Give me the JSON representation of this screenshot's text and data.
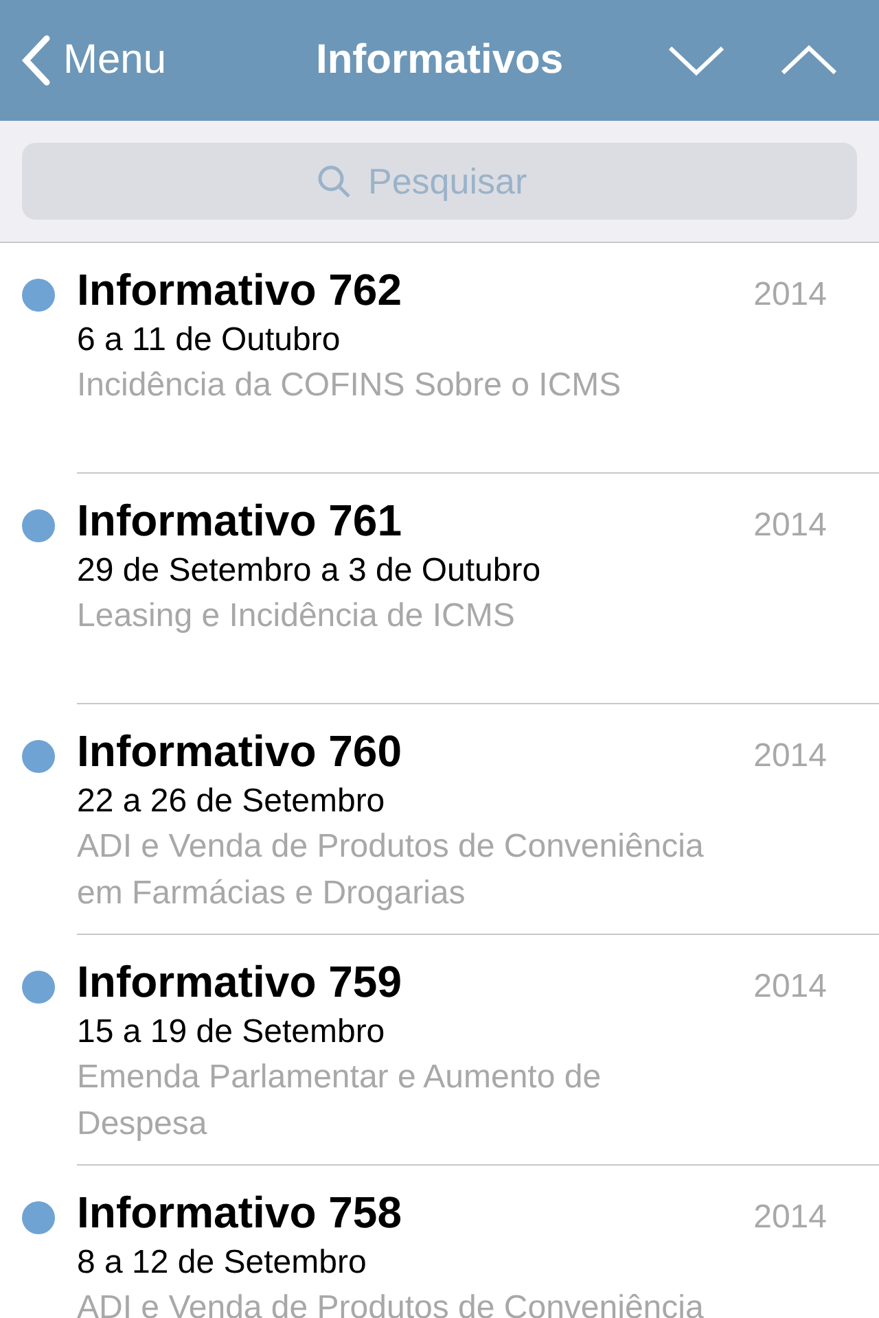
{
  "nav": {
    "back": "Menu",
    "title": "Informativos"
  },
  "search": {
    "placeholder": "Pesquisar"
  },
  "items": [
    {
      "title": "Informativo 762",
      "year": "2014",
      "period": "6 a 11 de Outubro",
      "subject": "Incidência da COFINS Sobre o ICMS",
      "unread": true
    },
    {
      "title": "Informativo 761",
      "year": "2014",
      "period": "29 de Setembro a 3 de Outubro",
      "subject": "Leasing e Incidência de ICMS",
      "unread": true
    },
    {
      "title": "Informativo 760",
      "year": "2014",
      "period": "22 a 26 de Setembro",
      "subject": "ADI e Venda de Produtos de Conveniência em Farmácias e Drogarias",
      "unread": true
    },
    {
      "title": "Informativo 759",
      "year": "2014",
      "period": "15 a 19 de Setembro",
      "subject": "Emenda Parlamentar e Aumento de Despesa",
      "unread": true
    },
    {
      "title": "Informativo 758",
      "year": "2014",
      "period": "8 a 12 de Setembro",
      "subject": "ADI e Venda de Produtos de Conveniência",
      "unread": true
    }
  ]
}
